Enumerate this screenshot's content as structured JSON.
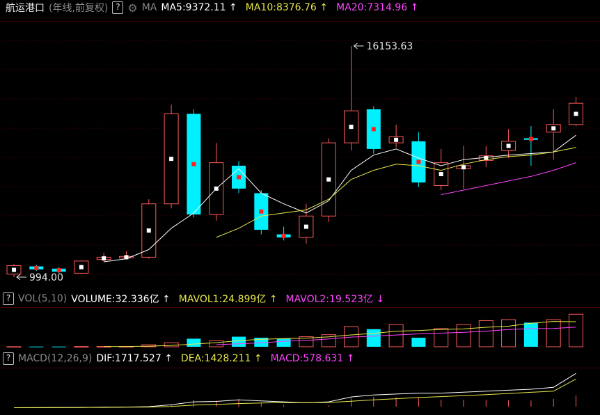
{
  "header": {
    "stock_name": "航运港口",
    "period": "(年线,前复权)",
    "help": "?",
    "ma_label": "MA",
    "ma5": "MA5:9372.11",
    "ma10": "MA10:8376.76",
    "ma20": "MA20:7314.96",
    "up_arrow": "↑",
    "down_arrow": "↓"
  },
  "vol_header": {
    "help": "?",
    "label": "VOL(5,10)",
    "volume": "VOLUME:32.336亿",
    "mavol1": "MAVOL1:24.899亿",
    "mavol2": "MAVOL2:19.523亿"
  },
  "macd_header": {
    "help": "?",
    "label": "MACD(12,26,9)",
    "dif": "DIF:1717.527",
    "dea": "DEA:1428.211",
    "macd": "MACD:578.631"
  },
  "annotations": {
    "max_label": "16153.63",
    "min_label": "994.00"
  },
  "colors": {
    "up": "#ff5a5a",
    "down": "#00f0ff",
    "ma5": "#ffffff",
    "ma10": "#e8e84a",
    "ma20": "#ff44ff",
    "grid": "#5a0000",
    "background": "#000000"
  },
  "chart_data": {
    "type": "candlestick",
    "price_range": [
      994.0,
      16153.63
    ],
    "candles": [
      {
        "o": 1190,
        "c": 1750,
        "h": 1850,
        "l": 994
      },
      {
        "o": 1700,
        "c": 1500,
        "h": 1800,
        "l": 1400
      },
      {
        "o": 1550,
        "c": 1350,
        "h": 1650,
        "l": 1250
      },
      {
        "o": 1250,
        "c": 2050,
        "h": 2100,
        "l": 1200
      },
      {
        "o": 2150,
        "c": 2300,
        "h": 2600,
        "l": 2000
      },
      {
        "o": 2250,
        "c": 2350,
        "h": 2700,
        "l": 2150
      },
      {
        "o": 2300,
        "c": 5800,
        "h": 6100,
        "l": 2200
      },
      {
        "o": 5800,
        "c": 11700,
        "h": 12300,
        "l": 5500
      },
      {
        "o": 11700,
        "c": 5100,
        "h": 12000,
        "l": 4900
      },
      {
        "o": 5100,
        "c": 8500,
        "h": 9800,
        "l": 4700
      },
      {
        "o": 8300,
        "c": 6800,
        "h": 8600,
        "l": 6500
      },
      {
        "o": 6500,
        "c": 4100,
        "h": 6700,
        "l": 3800
      },
      {
        "o": 3800,
        "c": 3600,
        "h": 4300,
        "l": 3400
      },
      {
        "o": 3600,
        "c": 5000,
        "h": 5800,
        "l": 3200
      },
      {
        "o": 5000,
        "c": 9800,
        "h": 10100,
        "l": 4600
      },
      {
        "o": 9800,
        "c": 11900,
        "h": 16153.63,
        "l": 9300
      },
      {
        "o": 12000,
        "c": 9400,
        "h": 12200,
        "l": 9100
      },
      {
        "o": 9800,
        "c": 10200,
        "h": 11000,
        "l": 9500
      },
      {
        "o": 9900,
        "c": 7200,
        "h": 10500,
        "l": 6900
      },
      {
        "o": 7000,
        "c": 8500,
        "h": 9400,
        "l": 6700
      },
      {
        "o": 8100,
        "c": 8300,
        "h": 9600,
        "l": 6800
      },
      {
        "o": 8650,
        "c": 8950,
        "h": 9600,
        "l": 8200
      },
      {
        "o": 9300,
        "c": 9900,
        "h": 10700,
        "l": 8800
      },
      {
        "o": 10100,
        "c": 10000,
        "h": 10900,
        "l": 8300
      },
      {
        "o": 10500,
        "c": 11000,
        "h": 12000,
        "l": 8700
      },
      {
        "o": 11000,
        "c": 12400,
        "h": 12800,
        "l": 10900
      }
    ],
    "ma5": [
      null,
      null,
      null,
      null,
      2000,
      2200,
      2800,
      4200,
      5200,
      6800,
      8100,
      6500,
      5800,
      5200,
      6000,
      8000,
      9000,
      9400,
      8800,
      8300,
      8700,
      8850,
      9000,
      9100,
      9200,
      10300
    ],
    "ma10": [
      null,
      null,
      null,
      null,
      null,
      null,
      null,
      null,
      null,
      3600,
      4200,
      5000,
      5200,
      5400,
      6100,
      7400,
      8000,
      8400,
      8300,
      8000,
      8400,
      8700,
      8900,
      9000,
      9200,
      9500
    ],
    "ma20": [
      null,
      null,
      null,
      null,
      null,
      null,
      null,
      null,
      null,
      null,
      null,
      null,
      null,
      null,
      null,
      null,
      null,
      null,
      null,
      6400,
      6700,
      7000,
      7300,
      7600,
      8000,
      8500
    ],
    "volume": {
      "values": [
        0.1,
        0.2,
        0.2,
        0.25,
        0.3,
        0.3,
        2.0,
        4.0,
        8.0,
        6.0,
        10.0,
        9.0,
        8.0,
        10.0,
        12.0,
        20.0,
        17.5,
        22.0,
        9.0,
        18.0,
        22.0,
        26.0,
        27.0,
        24.0,
        27.0,
        32.336
      ],
      "mavol1": [
        null,
        null,
        null,
        null,
        0.2,
        0.25,
        0.6,
        1.3,
        2.7,
        4.1,
        6.0,
        7.4,
        8.2,
        8.6,
        9.8,
        11.8,
        13.3,
        15.5,
        16.1,
        17.3,
        17.7,
        19.4,
        20.4,
        23.4,
        25.2,
        24.899
      ],
      "mavol2": [
        null,
        null,
        null,
        null,
        null,
        null,
        null,
        null,
        null,
        2.1,
        3.0,
        3.9,
        5.5,
        6.3,
        7.8,
        9.6,
        10.6,
        11.7,
        12.8,
        13.6,
        14.3,
        15.5,
        17.1,
        18.0,
        18.2,
        19.523
      ]
    },
    "macd": {
      "dif": [
        -55,
        -50,
        -45,
        -40,
        -30,
        -20,
        0,
        100,
        250,
        270,
        350,
        300,
        250,
        200,
        250,
        500,
        600,
        650,
        700,
        700,
        750,
        800,
        850,
        900,
        1000,
        1717.527
      ],
      "dea": [
        -55,
        -52,
        -48,
        -44,
        -38,
        -30,
        -20,
        10,
        80,
        120,
        160,
        190,
        205,
        210,
        215,
        280,
        350,
        410,
        470,
        520,
        570,
        620,
        680,
        740,
        800,
        1428.211
      ],
      "hist": [
        0,
        0,
        0,
        0,
        0,
        0,
        0,
        80,
        350,
        300,
        380,
        220,
        90,
        -20,
        70,
        440,
        500,
        480,
        460,
        360,
        360,
        360,
        340,
        320,
        400,
        578.631
      ]
    }
  }
}
